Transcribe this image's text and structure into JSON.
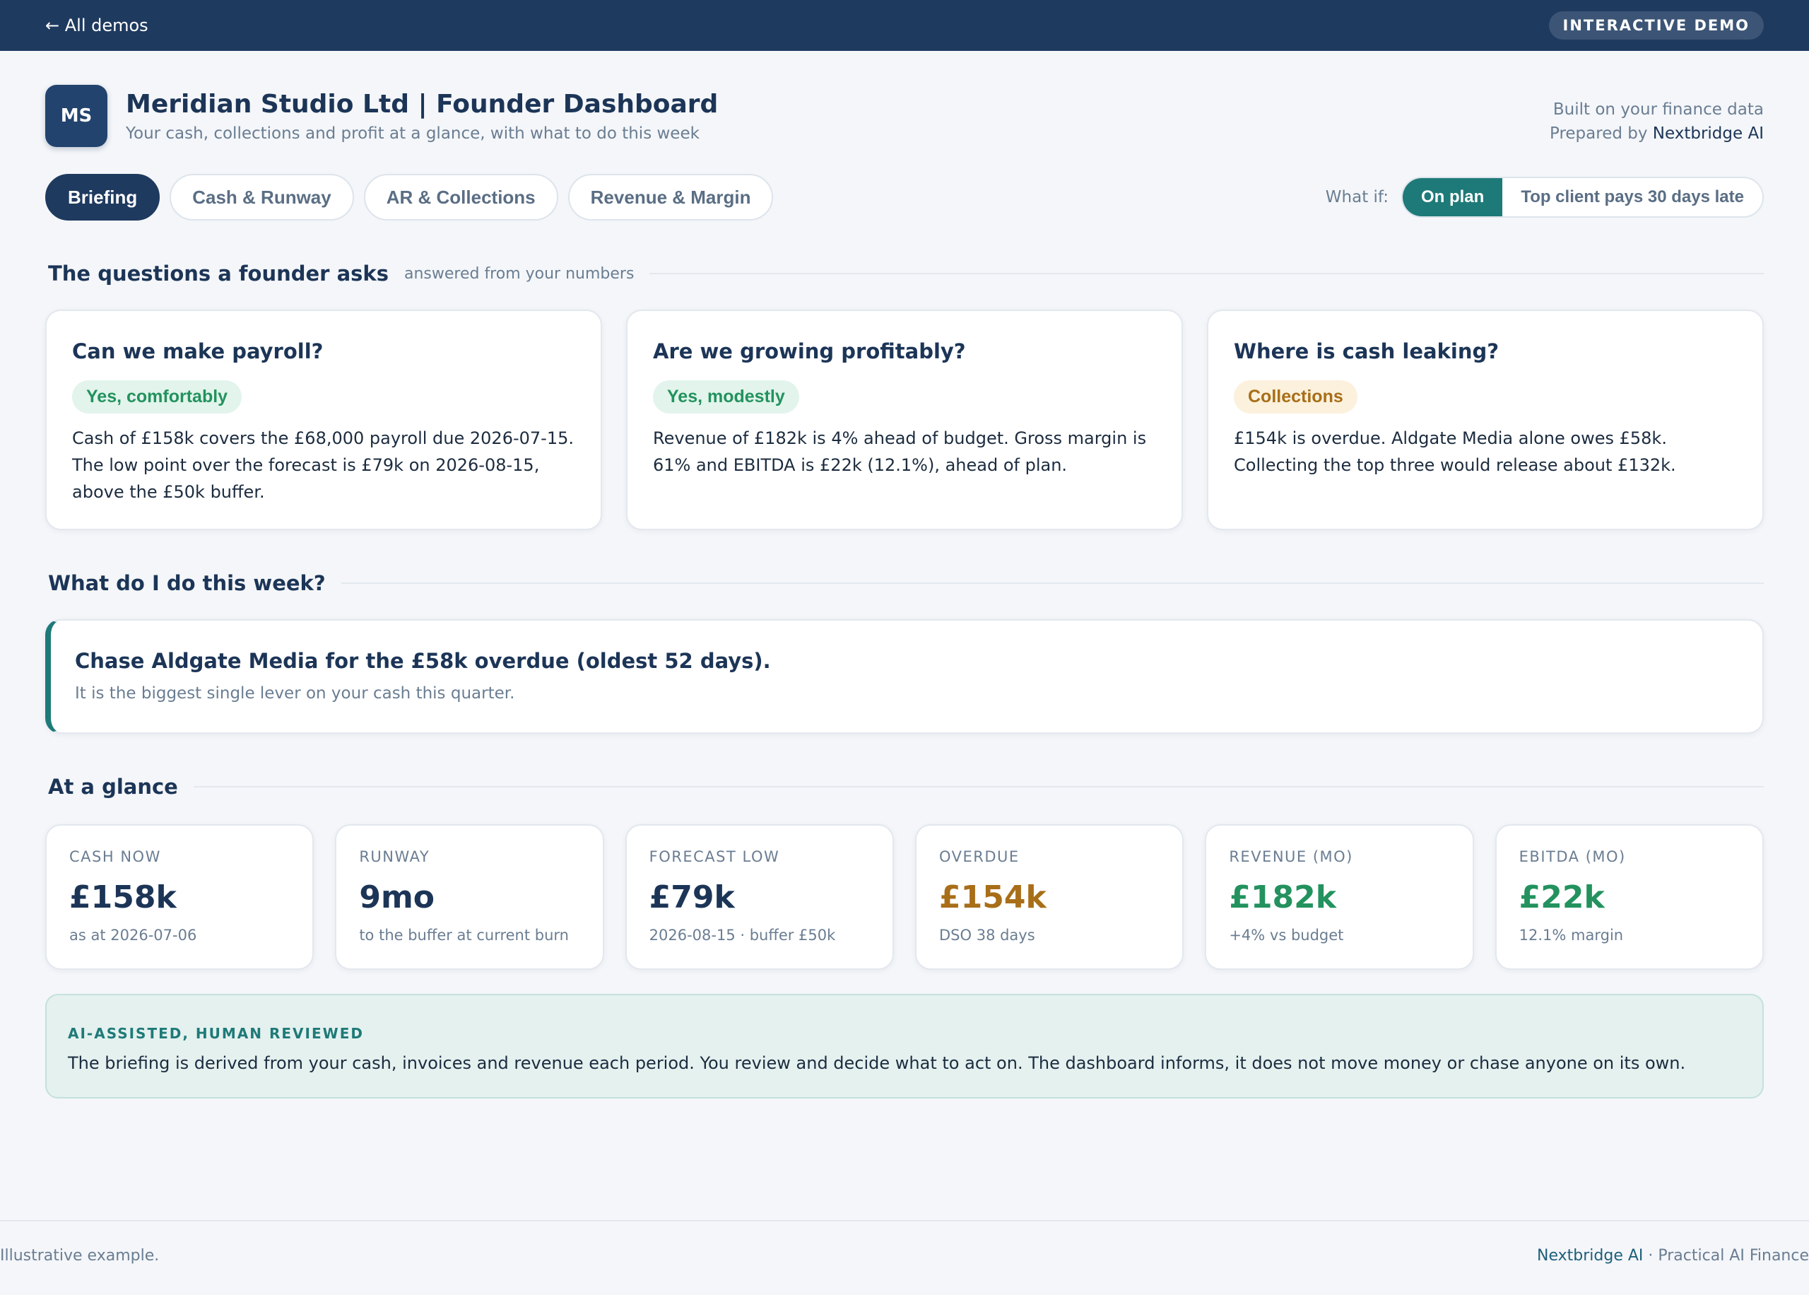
{
  "topbar": {
    "back_label": "← All demos",
    "badge": "INTERACTIVE DEMO"
  },
  "header": {
    "logo_initials": "MS",
    "title": "Meridian Studio Ltd | Founder Dashboard",
    "subtitle": "Your cash, collections and profit at a glance, with what to do this week",
    "built_on": "Built on your finance data",
    "prepared_prefix": "Prepared by",
    "prepared_company": "Nextbridge AI"
  },
  "tabs": [
    {
      "label": "Briefing",
      "active": true
    },
    {
      "label": "Cash & Runway",
      "active": false
    },
    {
      "label": "AR & Collections",
      "active": false
    },
    {
      "label": "Revenue & Margin",
      "active": false
    }
  ],
  "whatif": {
    "label": "What if:",
    "options": [
      {
        "label": "On plan",
        "active": true
      },
      {
        "label": "Top client pays 30 days late",
        "active": false
      }
    ]
  },
  "questions_section": {
    "title": "The questions a founder asks",
    "note": "answered from your numbers"
  },
  "questions": [
    {
      "title": "Can we make payroll?",
      "pill": "Yes, comfortably",
      "body": "Cash of £158k covers the £68,000 payroll due 2026-07-15. The low point over the forecast is £79k on 2026-08-15, above the £50k buffer."
    },
    {
      "title": "Are we growing profitably?",
      "pill": "Yes, modestly",
      "body": "Revenue of £182k is 4% ahead of budget. Gross margin is 61% and EBITDA is £22k (12.1%), ahead of plan."
    },
    {
      "title": "Where is cash leaking?",
      "pill": "Collections",
      "body": "£154k is overdue. Aldgate Media alone owes £58k. Collecting the top three would release about £132k."
    }
  ],
  "colors": {
    "navy": "#1f3a5f",
    "teal": "#1e7a78",
    "green": "#23925e",
    "amber": "#a86e18"
  },
  "action_section": {
    "title": "What do I do this week?"
  },
  "action": {
    "title": "Chase Aldgate Media for the £58k overdue (oldest 52 days).",
    "sub": "It is the biggest single lever on your cash this quarter."
  },
  "glance_section": {
    "title": "At a glance"
  },
  "kpis": [
    {
      "label": "CASH NOW",
      "value": "£158k",
      "sub": "as at 2026-07-06"
    },
    {
      "label": "RUNWAY",
      "value": "9mo",
      "sub": "to the buffer at current burn"
    },
    {
      "label": "FORECAST LOW",
      "value": "£79k",
      "sub": "2026-08-15 · buffer £50k"
    },
    {
      "label": "OVERDUE",
      "value": "£154k",
      "sub": "DSO 38 days"
    },
    {
      "label": "REVENUE (MO)",
      "value": "£182k",
      "sub": "+4% vs budget"
    },
    {
      "label": "EBITDA (MO)",
      "value": "£22k",
      "sub": "12.1% margin"
    }
  ],
  "note": {
    "title": "AI-ASSISTED, HUMAN REVIEWED",
    "body": "The briefing is derived from your cash, invoices and revenue each period. You review and decide what to act on. The dashboard informs, it does not move money or chase anyone on its own."
  },
  "footer": {
    "left": "Illustrative example.",
    "brand": "Nextbridge AI",
    "right_suffix": "· Practical AI Finance"
  }
}
